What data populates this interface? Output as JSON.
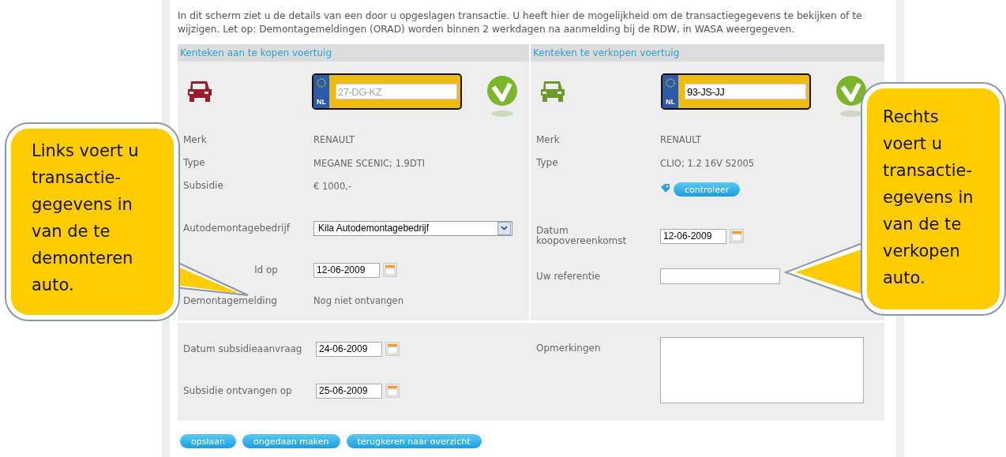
{
  "intro": "In dit scherm ziet u de details van een door u opgeslagen transactie. U heeft hier de mogelijkheid om de transactiegegevens te bekijken of te wijzigen. Let op: Demontagemeldingen (ORAD) worden binnen 2 werkdagen na aanmelding bij de RDW, in WASA weergegeven.",
  "columns": [
    {
      "header": "Kenteken aan te kopen voertuig",
      "color": "#9b1c24",
      "plate": {
        "country": "NL",
        "value": "27-DG-KZ",
        "disabled": true
      },
      "rows": [
        {
          "kind": "text",
          "label": "Merk",
          "value": "RENAULT"
        },
        {
          "kind": "text",
          "label": "Type",
          "value": "MEGANE SCENIC; 1.9DTI"
        },
        {
          "kind": "text",
          "label": "Subsidie",
          "value": "€ 1000,-"
        },
        {
          "kind": "select",
          "label": "Autodemontagebedrijf",
          "value": "Kila Autodemontagebedrijf"
        },
        {
          "kind": "date",
          "label": "ld op",
          "value": "12-06-2009"
        },
        {
          "kind": "text",
          "label": "Demontagemelding",
          "value": "Nog niet ontvangen"
        }
      ]
    },
    {
      "header": "Kenteken te verkopen voertuig",
      "color": "#6b9a2c",
      "plate": {
        "country": "NL",
        "value": "93-JS-JJ",
        "disabled": false
      },
      "rows": [
        {
          "kind": "text",
          "label": "Merk",
          "value": "RENAULT"
        },
        {
          "kind": "text",
          "label": "Type",
          "value": "CLIO; 1.2 16V S2005"
        },
        {
          "kind": "button",
          "value": "controleer"
        },
        {
          "kind": "date",
          "label": "Datum koopovereenkomst",
          "value": "12-06-2009"
        },
        {
          "kind": "input",
          "label": "Uw referentie"
        }
      ]
    }
  ],
  "lower": {
    "left": [
      {
        "label": "Datum subsidieaanvraag",
        "value": "24-06-2009"
      },
      {
        "label": "Subsidie ontvangen op",
        "value": "25-06-2009"
      }
    ],
    "right": {
      "label": "Opmerkingen"
    }
  },
  "buttons": [
    "opslaan",
    "ongedaan maken",
    "terugkeren naar overzicht"
  ],
  "callouts": [
    {
      "text": "Links voert u\ntransactie-\ngegevens in\nvan de te\ndemonteren\nauto."
    },
    {
      "text": "Rechts\nvoert u\ntransactie-\negevens in\nvan de te\nverkopen\nauto."
    }
  ]
}
